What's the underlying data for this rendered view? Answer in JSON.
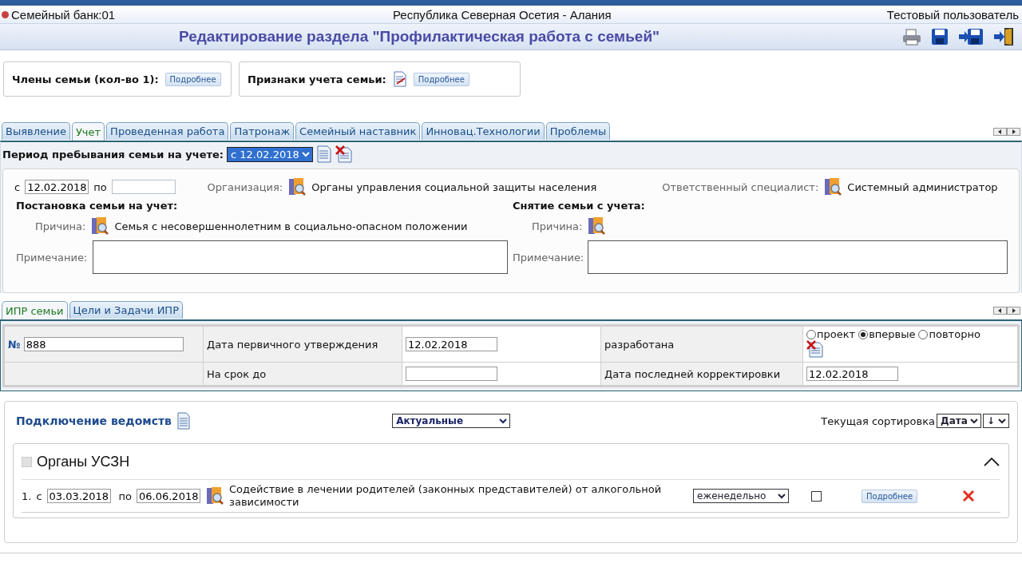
{
  "header": {
    "app": "Семейный банк:01",
    "region": "Республика Северная Осетия - Алания",
    "user": "Тестовый пользователь"
  },
  "title": "Редактирование раздела \"Профилактическая работа с семьей\"",
  "cards": [
    {
      "label": "Члены семьи (кол-во 1):",
      "button": "Подробнее",
      "icon": false
    },
    {
      "label": "Признаки учета семьи:",
      "button": "Подробнее",
      "icon": true
    }
  ],
  "tabs": [
    {
      "label": "Выявление",
      "selected": false
    },
    {
      "label": "Учет",
      "selected": true
    },
    {
      "label": "Проведенная работа",
      "selected": false
    },
    {
      "label": "Патронаж",
      "selected": false
    },
    {
      "label": "Семейный наставник",
      "selected": false
    },
    {
      "label": "Инновац.Технологии",
      "selected": false
    },
    {
      "label": "Проблемы",
      "selected": false
    }
  ],
  "period": {
    "label": "Период пребывания семьи на учете:",
    "value": "с 12.02.2018"
  },
  "record": {
    "from_label": "с",
    "from": "12.02.2018",
    "to_label": "по",
    "org_label": "Организация:",
    "org": "Органы управления социальной защиты населения",
    "spec_label": "Ответственный специалист:",
    "spec": "Системный администратор",
    "register": {
      "heading": "Постановка семьи на учет:",
      "reason_label": "Причина:",
      "reason": "Семья с несовершеннолетним в социально-опасном положении",
      "note_label": "Примечание:"
    },
    "deregister": {
      "heading": "Снятие семьи с учета:",
      "reason_label": "Причина:",
      "note_label": "Примечание:"
    }
  },
  "subtabs": [
    {
      "label": "ИПР семьи",
      "selected": true
    },
    {
      "label": "Цели и Задачи ИПР",
      "selected": false
    }
  ],
  "ipr": {
    "num_label": "№",
    "num": "888",
    "first_date_label": "Дата первичного утверждения",
    "first_date": "12.02.2018",
    "dev_label": "разработана",
    "options": [
      {
        "label": "проект",
        "selected": false
      },
      {
        "label": "впервые",
        "selected": true
      },
      {
        "label": "повторно",
        "selected": false
      }
    ],
    "term_label": "На срок до",
    "last_label": "Дата последней корректировки",
    "last": "12.02.2018"
  },
  "agencies": {
    "title": "Подключение ведомств",
    "filter": "Актуальные",
    "sort_label": "Текущая сортировка",
    "sort": "Дата",
    "order": "↓",
    "group": {
      "name": "Органы УСЗН",
      "checked": false,
      "expanded": true,
      "rows": [
        {
          "num": "1.",
          "from_label": "с",
          "from": "03.03.2018",
          "to_label": "по",
          "to": "06.06.2018",
          "text": "Содействие в лечении родителей (законных представителей) от алкогольной зависимости",
          "freq": "еженедельно",
          "checked": false,
          "button": "Подробнее"
        }
      ]
    }
  }
}
